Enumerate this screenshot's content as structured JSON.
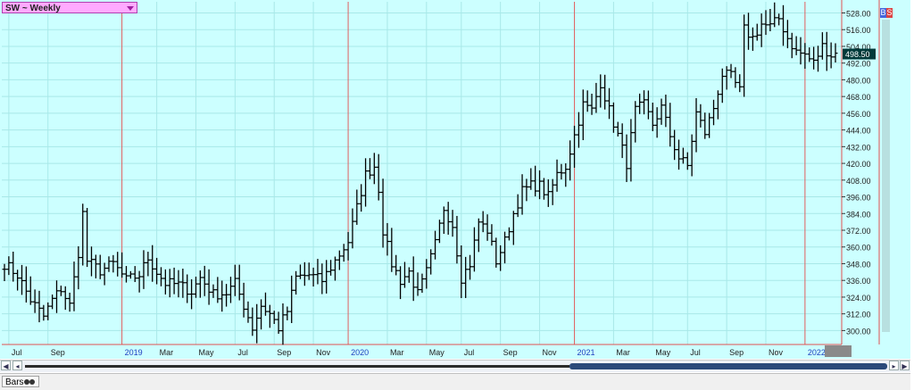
{
  "window": {
    "symbol_title": "SW ~ Weekly",
    "status_tab": "Bars"
  },
  "badges": {
    "buy": "B",
    "sell": "S"
  },
  "last_price": "498.50",
  "colors": {
    "background": "#ccffff",
    "grid": "#a8e8e8",
    "bars": "#000000",
    "axis_line": "#e05050",
    "title_bg": "#ffaaff",
    "price_tag": "#003a3a",
    "scroll_thumb": "#2b4a7a"
  },
  "chart_data": {
    "type": "bar",
    "style": "ohlc",
    "title": "SW ~ Weekly",
    "ylim": [
      290,
      536
    ],
    "y_ticks": [
      "528.00",
      "516.00",
      "504.00",
      "492.00",
      "480.00",
      "468.00",
      "456.00",
      "444.00",
      "432.00",
      "420.00",
      "408.00",
      "396.00",
      "384.00",
      "372.00",
      "360.00",
      "348.00",
      "336.00",
      "324.00",
      "312.00",
      "300.00"
    ],
    "y_tick_values": [
      528,
      516,
      504,
      492,
      480,
      468,
      456,
      444,
      432,
      420,
      408,
      396,
      384,
      372,
      360,
      348,
      336,
      324,
      312,
      300
    ],
    "x_ticks": [
      {
        "label": "Jul",
        "week": 1,
        "year": false
      },
      {
        "label": "Sep",
        "week": 10,
        "year": false
      },
      {
        "label": "2019",
        "week": 27,
        "year": true
      },
      {
        "label": "Mar",
        "week": 35,
        "year": false
      },
      {
        "label": "May",
        "week": 44,
        "year": false
      },
      {
        "label": "Jul",
        "week": 53,
        "year": false
      },
      {
        "label": "Sep",
        "week": 62,
        "year": false
      },
      {
        "label": "Nov",
        "week": 71,
        "year": false
      },
      {
        "label": "2020",
        "week": 79,
        "year": true
      },
      {
        "label": "Mar",
        "week": 88,
        "year": false
      },
      {
        "label": "May",
        "week": 97,
        "year": false
      },
      {
        "label": "Jul",
        "week": 105,
        "year": false
      },
      {
        "label": "Sep",
        "week": 114,
        "year": false
      },
      {
        "label": "Nov",
        "week": 123,
        "year": false
      },
      {
        "label": "2021",
        "week": 131,
        "year": true
      },
      {
        "label": "Mar",
        "week": 140,
        "year": false
      },
      {
        "label": "May",
        "week": 149,
        "year": false
      },
      {
        "label": "Jul",
        "week": 157,
        "year": false
      },
      {
        "label": "Sep",
        "week": 166,
        "year": false
      },
      {
        "label": "Nov",
        "week": 175,
        "year": false
      },
      {
        "label": "2022",
        "week": 184,
        "year": true
      }
    ],
    "last_value": 498.5,
    "grid": true,
    "close_path": [
      [
        0,
        348
      ],
      [
        3,
        340
      ],
      [
        6,
        322
      ],
      [
        9,
        310
      ],
      [
        11,
        322
      ],
      [
        13,
        330
      ],
      [
        15,
        318
      ],
      [
        17,
        356
      ],
      [
        18,
        384
      ],
      [
        19,
        350
      ],
      [
        22,
        343
      ],
      [
        25,
        348
      ],
      [
        28,
        336
      ],
      [
        31,
        340
      ],
      [
        33,
        352
      ],
      [
        35,
        342
      ],
      [
        37,
        334
      ],
      [
        40,
        333
      ],
      [
        43,
        328
      ],
      [
        45,
        338
      ],
      [
        48,
        326
      ],
      [
        51,
        327
      ],
      [
        53,
        334
      ],
      [
        55,
        318
      ],
      [
        57,
        302
      ],
      [
        59,
        318
      ],
      [
        61,
        312
      ],
      [
        63,
        302
      ],
      [
        65,
        314
      ],
      [
        67,
        338
      ],
      [
        70,
        340
      ],
      [
        73,
        336
      ],
      [
        76,
        350
      ],
      [
        79,
        364
      ],
      [
        81,
        388
      ],
      [
        83,
        412
      ],
      [
        85,
        418
      ],
      [
        86,
        402
      ],
      [
        87,
        372
      ],
      [
        89,
        348
      ],
      [
        91,
        336
      ],
      [
        93,
        342
      ],
      [
        95,
        326
      ],
      [
        97,
        342
      ],
      [
        99,
        362
      ],
      [
        101,
        388
      ],
      [
        103,
        376
      ],
      [
        105,
        338
      ],
      [
        107,
        348
      ],
      [
        109,
        378
      ],
      [
        111,
        372
      ],
      [
        113,
        350
      ],
      [
        115,
        364
      ],
      [
        117,
        384
      ],
      [
        119,
        400
      ],
      [
        121,
        404
      ],
      [
        123,
        404
      ],
      [
        125,
        396
      ],
      [
        127,
        412
      ],
      [
        129,
        418
      ],
      [
        131,
        440
      ],
      [
        133,
        462
      ],
      [
        135,
        458
      ],
      [
        137,
        478
      ],
      [
        139,
        458
      ],
      [
        141,
        440
      ],
      [
        143,
        420
      ],
      [
        145,
        458
      ],
      [
        147,
        462
      ],
      [
        149,
        448
      ],
      [
        151,
        460
      ],
      [
        153,
        440
      ],
      [
        155,
        424
      ],
      [
        157,
        418
      ],
      [
        159,
        456
      ],
      [
        161,
        442
      ],
      [
        163,
        460
      ],
      [
        165,
        484
      ],
      [
        167,
        482
      ],
      [
        169,
        472
      ],
      [
        170,
        516
      ],
      [
        172,
        510
      ],
      [
        174,
        520
      ],
      [
        176,
        518
      ],
      [
        178,
        524
      ],
      [
        180,
        510
      ],
      [
        182,
        500
      ],
      [
        184,
        498
      ],
      [
        186,
        492
      ],
      [
        188,
        504
      ],
      [
        190,
        498
      ]
    ]
  }
}
